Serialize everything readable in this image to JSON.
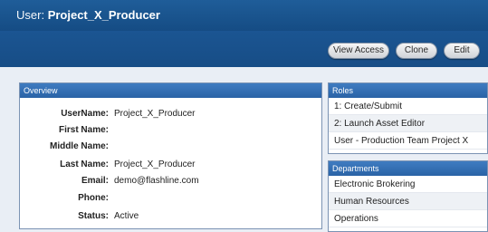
{
  "header": {
    "user_label": "User:",
    "user_name": "Project_X_Producer"
  },
  "toolbar": {
    "buttons": [
      "View Access",
      "Clone",
      "Edit"
    ]
  },
  "overview": {
    "title": "Overview",
    "fields": [
      {
        "label": "UserName:",
        "value": "Project_X_Producer"
      },
      {
        "label": "First Name:",
        "value": ""
      },
      {
        "label": "Middle Name:",
        "value": ""
      },
      {
        "label": "Last Name:",
        "value": "Project_X_Producer"
      },
      {
        "label": "Email:",
        "value": "demo@flashline.com"
      },
      {
        "label": "Phone:",
        "value": ""
      },
      {
        "label": "Status:",
        "value": "Active"
      }
    ]
  },
  "roles": {
    "title": "Roles",
    "items": [
      "1: Create/Submit",
      "2: Launch Asset Editor",
      "User - Production Team Project X"
    ]
  },
  "departments": {
    "title": "Departments",
    "items": [
      "Electronic Brokering",
      "Human Resources",
      "Operations"
    ]
  }
}
